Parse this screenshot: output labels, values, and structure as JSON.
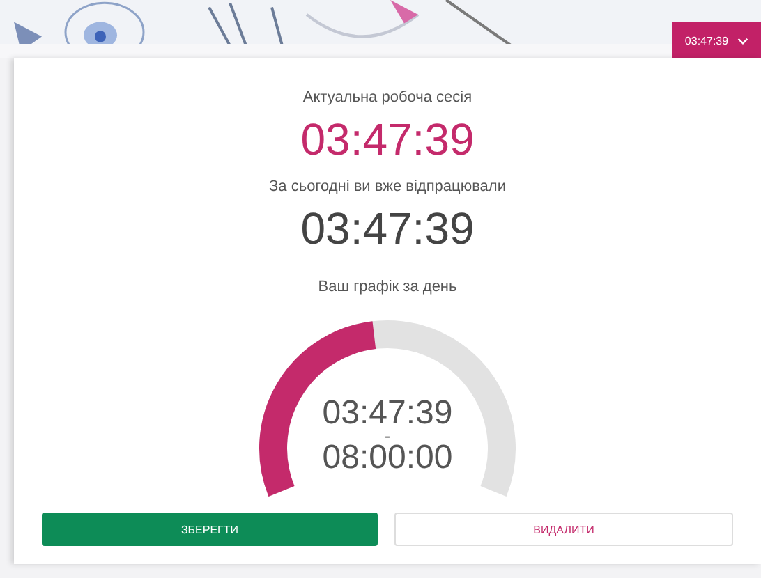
{
  "header": {
    "session_button": {
      "label": "03:47:39",
      "expanded": false
    }
  },
  "session": {
    "label": "Актуальна робоча сесія",
    "time": "03:47:39"
  },
  "today": {
    "label": "За сьогодні ви вже відпрацювали",
    "time": "03:47:39"
  },
  "schedule": {
    "label": "Ваш графік за день",
    "worked": "03:47:39",
    "separator": "-",
    "target": "08:00:00"
  },
  "buttons": [
    {
      "label": "ЗБЕРЕГТИ",
      "kind": "primary"
    },
    {
      "label": "ВИДАЛИТИ",
      "kind": "danger"
    }
  ]
}
